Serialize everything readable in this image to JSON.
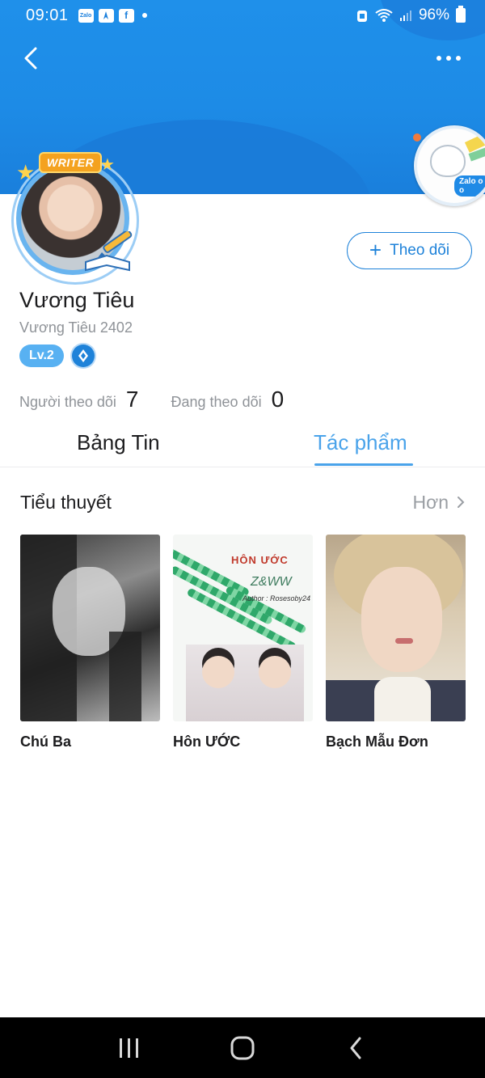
{
  "status_bar": {
    "time": "09:01",
    "notification_icons": [
      "Zalo",
      "app-icon",
      "facebook-icon"
    ],
    "battery": "96%"
  },
  "profile": {
    "display_name": "Vương Tiêu",
    "username": "Vương Tiêu 2402",
    "badge_text": "WRITER",
    "level": "Lv.2",
    "follow_button_label": "Theo dõi",
    "sticker_text": "Zalo o o"
  },
  "stats": {
    "followers_label": "Người theo dõi",
    "followers_count": "7",
    "following_label": "Đang theo dõi",
    "following_count": "0"
  },
  "tabs": [
    {
      "label": "Bảng Tin",
      "active": false
    },
    {
      "label": "Tác phẩm",
      "active": true
    }
  ],
  "section": {
    "title": "Tiểu thuyết",
    "more_label": "Hơn"
  },
  "books": [
    {
      "title": "Chú Ba"
    },
    {
      "title": "Hôn ƯỚC",
      "cover_title": "HÔN ƯỚC",
      "cover_subtitle": "Z&WW",
      "cover_author": "Author : Rosesoby24"
    },
    {
      "title": "Bạch Mẫu Đơn"
    }
  ],
  "colors": {
    "header_blue": "#1f90ea",
    "accent_blue": "#1e82d9",
    "active_tab": "#4aa3ea",
    "level_badge": "#58b1f2",
    "writer_badge": "#f4a21f"
  }
}
